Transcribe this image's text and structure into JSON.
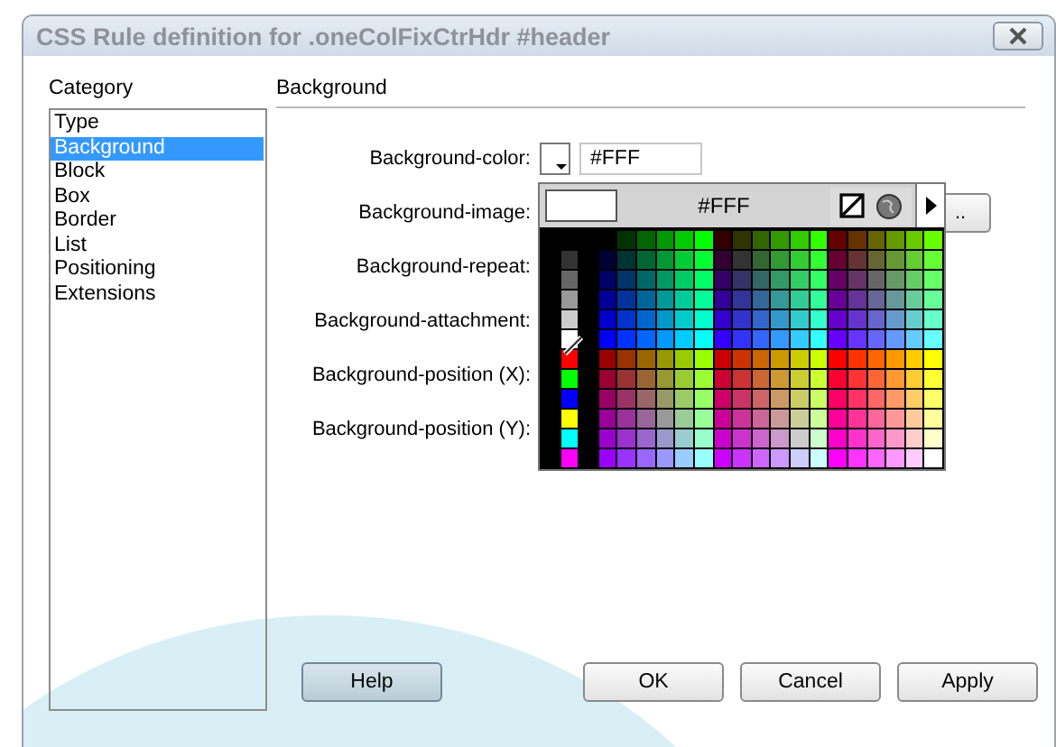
{
  "window": {
    "title": "CSS Rule definition for .oneColFixCtrHdr #header"
  },
  "category": {
    "label": "Category",
    "items": [
      {
        "label": "Type",
        "selected": false
      },
      {
        "label": "Background",
        "selected": true
      },
      {
        "label": "Block",
        "selected": false
      },
      {
        "label": "Box",
        "selected": false
      },
      {
        "label": "Border",
        "selected": false
      },
      {
        "label": "List",
        "selected": false
      },
      {
        "label": "Positioning",
        "selected": false
      },
      {
        "label": "Extensions",
        "selected": false
      }
    ]
  },
  "panel": {
    "title": "Background",
    "fields": [
      {
        "label": "Background-color:",
        "kind": "color",
        "value": "#FFF"
      },
      {
        "label": "Background-image:",
        "kind": "browse",
        "button": ".."
      },
      {
        "label": "Background-repeat:",
        "kind": "plain"
      },
      {
        "label": "Background-attachment:",
        "kind": "plain"
      },
      {
        "label": "Background-position (X):",
        "kind": "plain"
      },
      {
        "label": "Background-position (Y):",
        "kind": "plain"
      }
    ]
  },
  "color_picker": {
    "value": "#FFF"
  },
  "help_button": {
    "label": "Help"
  },
  "buttons": [
    {
      "label": "OK"
    },
    {
      "label": "Cancel"
    },
    {
      "label": "Apply"
    }
  ]
}
